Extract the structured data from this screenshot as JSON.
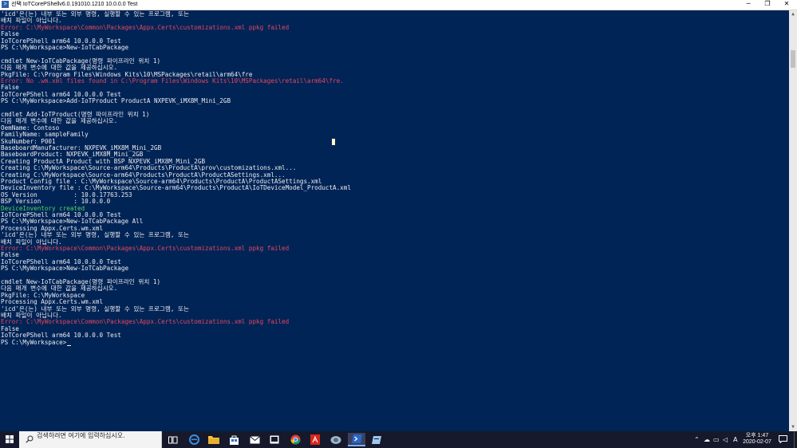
{
  "window": {
    "title": "선택 IoTCorePShellv6.0.191010.1210 10.0.0.0 Test",
    "minimize_glyph": "─",
    "maximize_glyph": "❐",
    "close_glyph": "✕"
  },
  "console": {
    "lines": [
      {
        "text": "'icd'은(는) 내부 또는 외부 명령, 실행할 수 있는 프로그램, 또는",
        "kind": "plain"
      },
      {
        "text": "배치 파일이 아닙니다.",
        "kind": "plain"
      },
      {
        "text": "Error: C:\\MyWorkspace\\Common\\Packages\\Appx.Certs\\customizations.xml ppkg failed",
        "kind": "err"
      },
      {
        "text": "False",
        "kind": "plain"
      },
      {
        "text": "IoTCorePShell arm64 10.0.0.0 Test",
        "kind": "plain"
      },
      {
        "text": "PS C:\\MyWorkspace>New-IoTCabPackage",
        "kind": "plain"
      },
      {
        "text": "",
        "kind": "plain"
      },
      {
        "text": "cmdlet New-IoTCabPackage(명령 파이프라인 위치 1)",
        "kind": "plain"
      },
      {
        "text": "다음 매개 변수에 대한 값을 제공하십시오.",
        "kind": "plain"
      },
      {
        "text": "PkgFile: C:\\Program Files\\Windows Kits\\10\\MSPackages\\retail\\arm64\\fre",
        "kind": "plain"
      },
      {
        "text": "Error: No .wm.xml files found in C:\\Program Files\\Windows Kits\\10\\MSPackages\\retail\\arm64\\fre.",
        "kind": "err"
      },
      {
        "text": "False",
        "kind": "plain"
      },
      {
        "text": "IoTCorePShell arm64 10.0.0.0 Test",
        "kind": "plain"
      },
      {
        "text": "PS C:\\MyWorkspace>Add-IoTProduct ProductA NXPEVK_iMX8M_Mini_2GB",
        "kind": "plain"
      },
      {
        "text": "",
        "kind": "plain"
      },
      {
        "text": "cmdlet Add-IoTProduct(명령 파이프라인 위치 1)",
        "kind": "plain"
      },
      {
        "text": "다음 매개 변수에 대한 값을 제공하십시오.",
        "kind": "plain"
      },
      {
        "text": "OemName: Contoso",
        "kind": "plain"
      },
      {
        "text": "FamilyName: sampleFamily",
        "kind": "plain"
      },
      {
        "text": "SkuNumber: P001",
        "kind": "plain"
      },
      {
        "text": "BaseboardManufacturer: NXPEVK_iMX8M_Mini_2GB",
        "kind": "plain"
      },
      {
        "text": "BaseboardProduct: NXPEVK_iMX8M_Mini_2GB",
        "kind": "plain"
      },
      {
        "text": "Creating ProductA Product with BSP NXPEVK_iMX8M_Mini_2GB",
        "kind": "plain"
      },
      {
        "text": "Creating C:\\MyWorkspace\\Source-arm64\\Products\\ProductA\\prov\\customizations.xml...",
        "kind": "plain"
      },
      {
        "text": "Creating C:\\MyWorkspace\\Source-arm64\\Products\\ProductA\\ProductASettings.xml...",
        "kind": "plain"
      },
      {
        "text": "Product Config file : C:\\MyWorkspace\\Source-arm64\\Products\\ProductA\\ProductASettings.xml",
        "kind": "plain"
      },
      {
        "text": "DeviceInventory file : C:\\MyWorkspace\\Source-arm64\\Products\\ProductA\\IoTDeviceModel_ProductA.xml",
        "kind": "plain"
      },
      {
        "text": "OS Version          : 10.0.17763.253",
        "kind": "plain"
      },
      {
        "text": "BSP Version         : 10.0.0.0",
        "kind": "plain"
      },
      {
        "text": "DeviceInventory created",
        "kind": "ok"
      },
      {
        "text": "IoTCorePShell arm64 10.0.0.0 Test",
        "kind": "plain"
      },
      {
        "text": "PS C:\\MyWorkspace>New-IoTCabPackage All",
        "kind": "plain"
      },
      {
        "text": "Processing Appx.Certs.wm.xml",
        "kind": "plain"
      },
      {
        "text": "'icd'은(는) 내부 또는 외부 명령, 실행할 수 있는 프로그램, 또는",
        "kind": "plain"
      },
      {
        "text": "배치 파일이 아닙니다.",
        "kind": "plain"
      },
      {
        "text": "Error: C:\\MyWorkspace\\Common\\Packages\\Appx.Certs\\customizations.xml ppkg failed",
        "kind": "err"
      },
      {
        "text": "False",
        "kind": "plain"
      },
      {
        "text": "IoTCorePShell arm64 10.0.0.0 Test",
        "kind": "plain"
      },
      {
        "text": "PS C:\\MyWorkspace>New-IoTCabPackage",
        "kind": "plain"
      },
      {
        "text": "",
        "kind": "plain"
      },
      {
        "text": "cmdlet New-IoTCabPackage(명령 파이프라인 위치 1)",
        "kind": "plain"
      },
      {
        "text": "다음 매개 변수에 대한 값을 제공하십시오.",
        "kind": "plain"
      },
      {
        "text": "PkgFile: C:\\MyWorkspace",
        "kind": "plain"
      },
      {
        "text": "Processing Appx.Certs.wm.xml",
        "kind": "plain"
      },
      {
        "text": "'icd'은(는) 내부 또는 외부 명령, 실행할 수 있는 프로그램, 또는",
        "kind": "plain"
      },
      {
        "text": "배치 파일이 아닙니다.",
        "kind": "plain"
      },
      {
        "text": "Error: C:\\MyWorkspace\\Common\\Packages\\Appx.Certs\\customizations.xml ppkg failed",
        "kind": "err"
      },
      {
        "text": "False",
        "kind": "plain"
      },
      {
        "text": "IoTCorePShell arm64 10.0.0.0 Test",
        "kind": "plain"
      },
      {
        "text": "PS C:\\MyWorkspace>",
        "kind": "plain"
      }
    ]
  },
  "colors": {
    "console_bg": "#012456",
    "text": "#eeedf0",
    "error": "#e8455e",
    "success": "#4ed85f"
  },
  "taskbar": {
    "search_placeholder": "검색하려면 여기에 입력하십시오.",
    "pinned_icons": [
      "task-view-icon",
      "edge-icon",
      "file-explorer-icon",
      "store-icon",
      "mail-icon",
      "tablet-app-icon",
      "chrome-icon",
      "acrobat-icon",
      "network-tool-icon",
      "powershell-icon",
      "app-icon"
    ],
    "active_app": "powershell-icon",
    "tray": {
      "language": "A",
      "time": "오후 1:47",
      "date": "2020-02-07"
    }
  }
}
